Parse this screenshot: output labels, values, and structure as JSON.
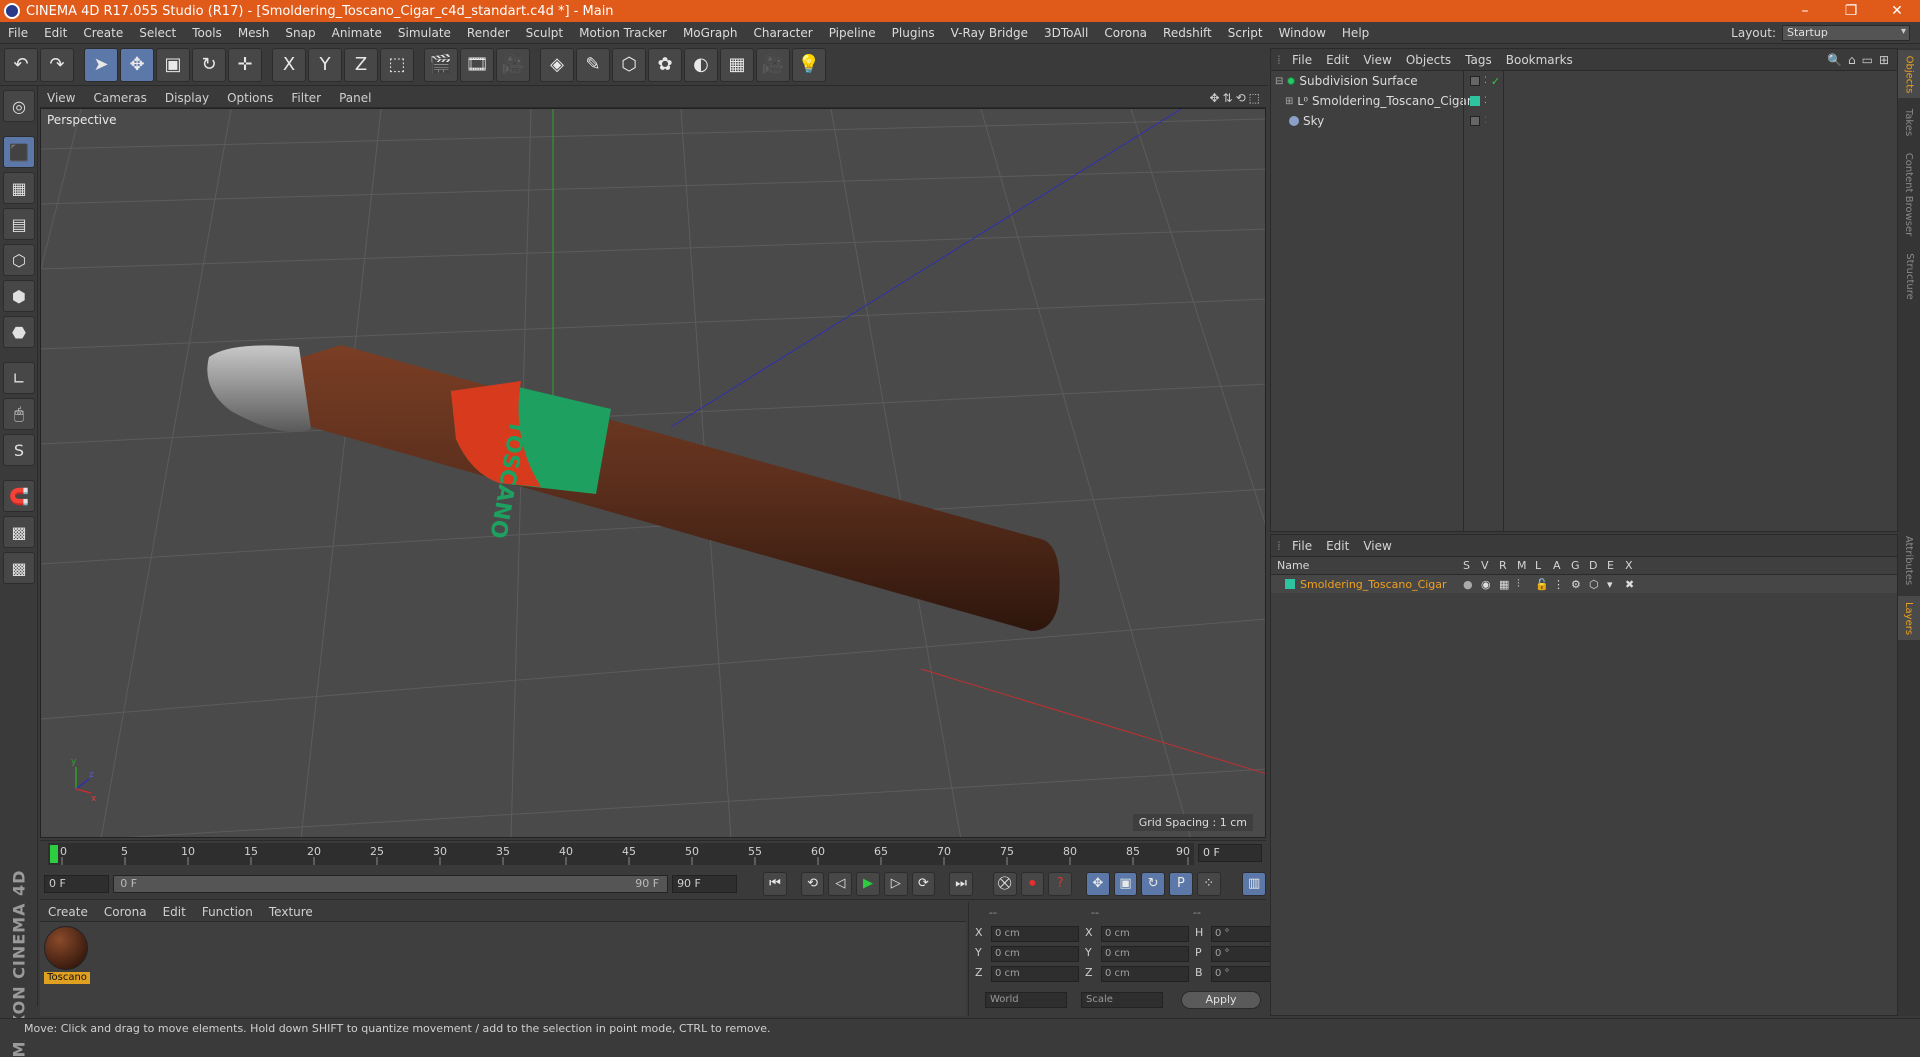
{
  "window": {
    "title": "CINEMA 4D R17.055 Studio (R17) - [Smoldering_Toscano_Cigar_c4d_standart.c4d *] - Main",
    "controls": [
      "–",
      "❐",
      "✕"
    ]
  },
  "menu": {
    "items": [
      "File",
      "Edit",
      "Create",
      "Select",
      "Tools",
      "Mesh",
      "Snap",
      "Animate",
      "Simulate",
      "Render",
      "Sculpt",
      "Motion Tracker",
      "MoGraph",
      "Character",
      "Pipeline",
      "Plugins",
      "V-Ray Bridge",
      "3DToAll",
      "Corona",
      "Redshift",
      "Script",
      "Window",
      "Help"
    ],
    "layout_label": "Layout:",
    "layout_value": "Startup"
  },
  "toolbar": {
    "icons": [
      "↶",
      "↷",
      "➤",
      "✥",
      "▣",
      "↻",
      "✛",
      "X",
      "Y",
      "Z",
      "⬚",
      "🎬",
      "🎞",
      "🎥",
      "◈",
      "✎",
      "⬡",
      "✿",
      "◐",
      "▦",
      "🎥",
      "💡"
    ]
  },
  "left_tools": {
    "icons": [
      "◎",
      "⬛",
      "▦",
      "▤",
      "⬡",
      "⬢",
      "⬣",
      "∟",
      "🖱",
      "S",
      "🧲",
      "▩",
      "▩"
    ]
  },
  "viewport": {
    "menu": [
      "View",
      "Cameras",
      "Display",
      "Options",
      "Filter",
      "Panel"
    ],
    "icons": [
      "✥",
      "⇅",
      "⟲",
      "⬚"
    ],
    "label": "Perspective",
    "grid_spacing": "Grid Spacing : 1 cm",
    "band_text": "TOSCANO",
    "axis_labels": {
      "y": "y",
      "z": "z",
      "x": "x"
    },
    "colors": {
      "background": "#4a4a4a",
      "grid": "#5a5a5a",
      "x_axis": "#c03030",
      "y_axis": "#30a030",
      "z_axis": "#3030b0",
      "cigar": "#5a2e1c",
      "band_red": "#d83a1e",
      "band_green": "#1ea060",
      "ash": "#9a9a9a"
    }
  },
  "timeline": {
    "ticks": [
      "0",
      "5",
      "10",
      "15",
      "20",
      "25",
      "30",
      "35",
      "40",
      "45",
      "50",
      "55",
      "60",
      "65",
      "70",
      "75",
      "80",
      "85",
      "90"
    ],
    "current_frame": "0 F",
    "start": "0 F",
    "range_start": "0 F",
    "range_end": "90 F",
    "end": "90 F",
    "play_icons": [
      "⏮",
      "⟲",
      "◁",
      "▶",
      "▷",
      "⟳",
      "⏭"
    ],
    "rec_icons": [
      "⛒",
      "⏺",
      "?",
      "✥",
      "▣",
      "↻",
      "P",
      "⁘",
      "▥"
    ]
  },
  "material": {
    "menu": [
      "Create",
      "Corona",
      "Edit",
      "Function",
      "Texture"
    ],
    "name": "Toscano"
  },
  "coordinates": {
    "header": [
      "--",
      "--",
      "--"
    ],
    "rows": [
      {
        "a": "X",
        "av": "0 cm",
        "b": "X",
        "bv": "0 cm",
        "c": "H",
        "cv": "0 °"
      },
      {
        "a": "Y",
        "av": "0 cm",
        "b": "Y",
        "bv": "0 cm",
        "c": "P",
        "cv": "0 °"
      },
      {
        "a": "Z",
        "av": "0 cm",
        "b": "Z",
        "bv": "0 cm",
        "c": "B",
        "cv": "0 °"
      }
    ],
    "world": "World",
    "scale": "Scale",
    "apply": "Apply"
  },
  "brand": "MAXON CINEMA 4D",
  "status": "Move: Click and drag to move elements. Hold down SHIFT to quantize movement / add to the selection in point mode, CTRL to remove.",
  "objects": {
    "menu": [
      "File",
      "Edit",
      "View",
      "Objects",
      "Tags",
      "Bookmarks"
    ],
    "icons": [
      "🔍",
      "⌂",
      "▭",
      "⊞"
    ],
    "items": [
      {
        "name": "Subdivision Surface",
        "icon": "subdivision-icon",
        "indent": 0
      },
      {
        "name": "Smoldering_Toscano_Cigar",
        "icon": "null-object-icon",
        "indent": 1
      },
      {
        "name": "Sky",
        "icon": "sky-icon",
        "indent": 0
      }
    ]
  },
  "layers": {
    "menu": [
      "File",
      "Edit",
      "View"
    ],
    "header_name": "Name",
    "header_cols": [
      "S",
      "V",
      "R",
      "M",
      "L",
      "A",
      "G",
      "D",
      "E",
      "X"
    ],
    "row_name": "Smoldering_Toscano_Cigar",
    "row_color": "#2ec4a0"
  },
  "side_tabs": [
    "Objects",
    "Takes",
    "Content Browser",
    "Structure",
    "Attributes",
    "Layers"
  ]
}
